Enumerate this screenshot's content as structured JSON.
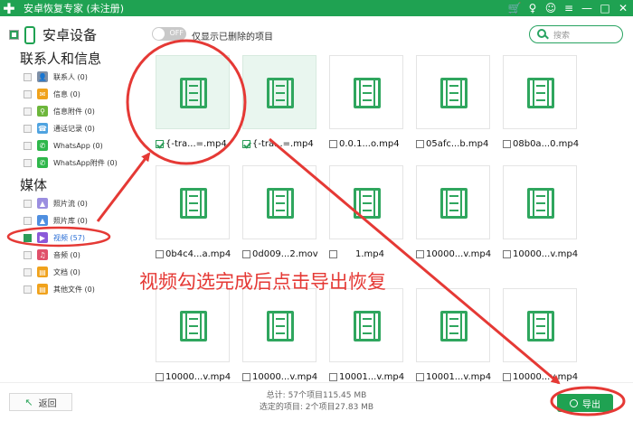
{
  "window": {
    "title": "安卓恢复专家 (未注册)",
    "logo_icon": "plus-logo-icon",
    "tools": [
      "cart-icon",
      "key-icon",
      "chat-icon",
      "menu-icon",
      "minimize-icon",
      "maximize-icon",
      "close-icon"
    ],
    "tool_glyphs": [
      "🛒",
      "♀",
      "☺",
      "≡",
      "—",
      "□",
      "✕"
    ]
  },
  "sidebar": {
    "device_label": "安卓设备",
    "sections": [
      {
        "title": "联系人和信息",
        "items": [
          {
            "label": "联系人 (0)",
            "icon": "contacts-icon",
            "color": "#7e8fa6"
          },
          {
            "label": "信息 (0)",
            "icon": "message-icon",
            "color": "#f0a21c"
          },
          {
            "label": "信息附件 (0)",
            "icon": "attachment-icon",
            "color": "#6db63b"
          },
          {
            "label": "通话记录 (0)",
            "icon": "call-log-icon",
            "color": "#4fa3e0"
          },
          {
            "label": "WhatsApp (0)",
            "icon": "whatsapp-icon",
            "color": "#2fb74b"
          },
          {
            "label": "WhatsApp附件 (0)",
            "icon": "whatsapp-attachment-icon",
            "color": "#2fb74b"
          }
        ]
      },
      {
        "title": "媒体",
        "items": [
          {
            "label": "照片流 (0)",
            "icon": "photo-stream-icon",
            "color": "#9b8ee0"
          },
          {
            "label": "照片库 (0)",
            "icon": "photo-library-icon",
            "color": "#4f8fe0"
          },
          {
            "label": "视频 (57)",
            "icon": "video-icon",
            "color": "#8b59d9"
          },
          {
            "label": "音频 (0)",
            "icon": "audio-icon",
            "color": "#e0506a"
          },
          {
            "label": "文档 (0)",
            "icon": "document-icon",
            "color": "#f0a21c"
          },
          {
            "label": "其他文件 (0)",
            "icon": "other-files-icon",
            "color": "#f0a21c"
          }
        ]
      }
    ]
  },
  "toolbar": {
    "toggle_text": "OFF",
    "toggle_label": "仅显示已删除的项目",
    "search_placeholder": "搜索"
  },
  "files": [
    {
      "name": "{-tra...=.mp4",
      "selected": true
    },
    {
      "name": "{-tra...=.mp4",
      "selected": true
    },
    {
      "name": "0.0.1...o.mp4",
      "selected": false
    },
    {
      "name": "05afc...b.mp4",
      "selected": false
    },
    {
      "name": "08b0a...0.mp4",
      "selected": false
    },
    {
      "name": "0b4c4...a.mp4",
      "selected": false
    },
    {
      "name": "0d009...2.mov",
      "selected": false
    },
    {
      "name": "1.mp4",
      "selected": false
    },
    {
      "name": "10000...v.mp4",
      "selected": false
    },
    {
      "name": "10000...v.mp4",
      "selected": false
    },
    {
      "name": "10000...v.mp4",
      "selected": false
    },
    {
      "name": "10000...v.mp4",
      "selected": false
    },
    {
      "name": "10001...v.mp4",
      "selected": false
    },
    {
      "name": "10001...v.mp4",
      "selected": false
    },
    {
      "name": "10000...v.mp4",
      "selected": false
    }
  ],
  "footer": {
    "back_label": "返回",
    "total": "总计: 57个项目115.45 MB",
    "selected": "选定的项目: 2个项目27.83 MB",
    "export_label": "导出"
  },
  "annotation": {
    "text": "视频勾选完成后点击导出恢复",
    "color": "#e53935"
  }
}
